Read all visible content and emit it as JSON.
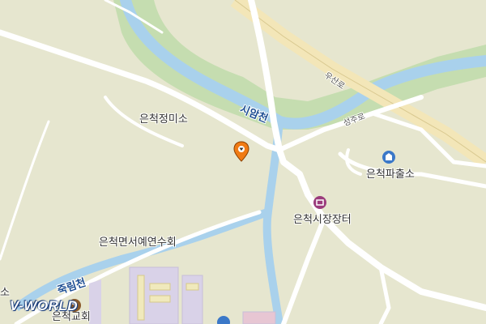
{
  "map": {
    "place_labels": {
      "eunchuk_jeongmiso": "은척정미소",
      "police_box": "은척파출소",
      "market": "은척시장장터",
      "township_association": "은척면서예연수회",
      "church": "은척교회",
      "left_edge": "소"
    },
    "water_labels": {
      "siam_stream": "시암천",
      "jukrim_stream": "죽림천"
    },
    "road_labels": {
      "usan_ro": "우산로",
      "seongju_ro": "성주로"
    },
    "icons": {
      "police": "police-icon",
      "market": "market-icon",
      "church": "church-icon",
      "pin": "location-pin-icon",
      "school": "school-icon"
    },
    "colors": {
      "land": "#e6e6cf",
      "green": "#c5ddb0",
      "water": "#a9d1ec",
      "road": "#ffffff",
      "highway": "#f3e6b8",
      "pin": "#f07b14",
      "poi_blue": "#3b78c8",
      "poi_purple": "#9b3c7c"
    }
  },
  "logo": {
    "text": "V-WORLD"
  }
}
